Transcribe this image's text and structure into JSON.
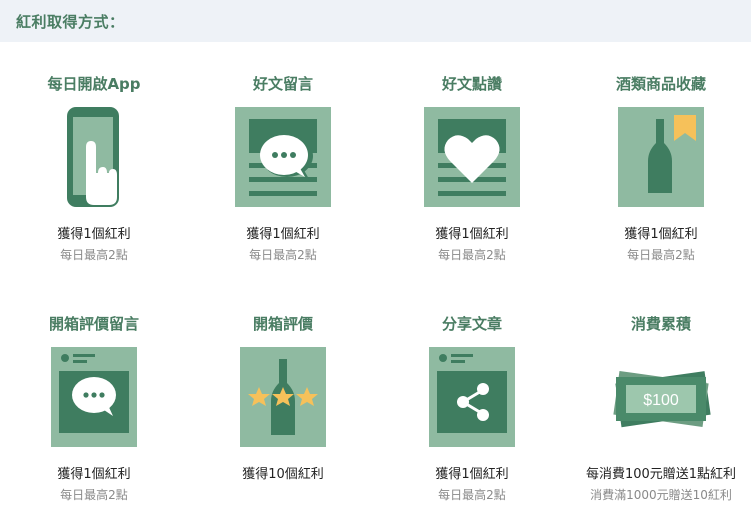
{
  "header": {
    "title": "紅利取得方式："
  },
  "colors": {
    "accent": "#4a7d63",
    "tile": "#8fbaa1",
    "dark": "#3f7d60",
    "star": "#f6c15a"
  },
  "methods": [
    {
      "title": "每日開啟App",
      "reward": "獲得1個紅利",
      "limit": "每日最高2點",
      "icon": "phone-tap-icon"
    },
    {
      "title": "好文留言",
      "reward": "獲得1個紅利",
      "limit": "每日最高2點",
      "icon": "article-comment-icon"
    },
    {
      "title": "好文點讚",
      "reward": "獲得1個紅利",
      "limit": "每日最高2點",
      "icon": "article-heart-icon"
    },
    {
      "title": "酒類商品收藏",
      "reward": "獲得1個紅利",
      "limit": "每日最高2點",
      "icon": "bottle-bookmark-icon"
    },
    {
      "title": "開箱評價留言",
      "reward": "獲得1個紅利",
      "limit": "每日最高2點",
      "icon": "review-comment-icon"
    },
    {
      "title": "開箱評價",
      "reward": "獲得10個紅利",
      "limit": "",
      "icon": "bottle-stars-icon"
    },
    {
      "title": "分享文章",
      "reward": "獲得1個紅利",
      "limit": "每日最高2點",
      "icon": "share-icon"
    },
    {
      "title": "消費累積",
      "reward": "每消費100元贈送1點紅利",
      "limit": "消費滿1000元贈送10紅利",
      "icon": "cash-icon",
      "cash_label": "$100"
    }
  ]
}
